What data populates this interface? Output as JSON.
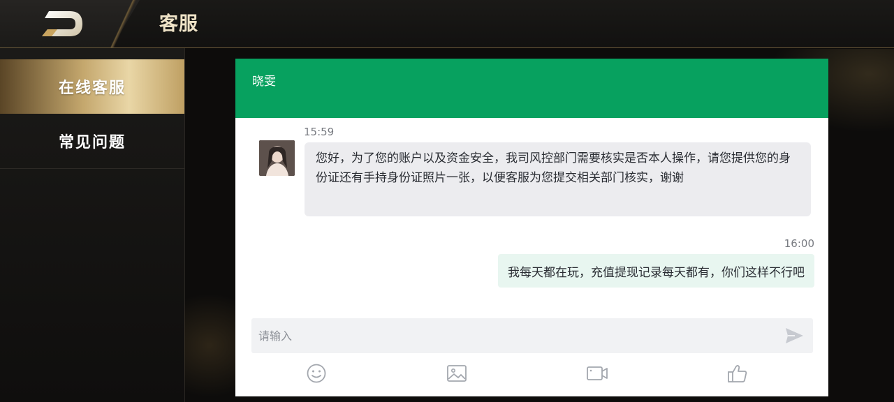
{
  "header": {
    "title": "客服",
    "logo_icon": "d-logo-icon"
  },
  "sidebar": {
    "items": [
      {
        "label": "在线客服",
        "active": true
      },
      {
        "label": "常见问题",
        "active": false
      }
    ]
  },
  "chat": {
    "agent_name": "晓雯",
    "header_color": "#07a15f",
    "messages": [
      {
        "direction": "incoming",
        "time": "15:59",
        "text": "您好，为了您的账户以及资金安全，我司风控部门需要核实是否本人操作，请您提供您的身份证还有手持身份证照片一张，以便客服为您提交相关部门核实，谢谢"
      },
      {
        "direction": "outgoing",
        "time": "16:00",
        "text": "我每天都在玩，充值提现记录每天都有，你们这样不行吧"
      }
    ],
    "input": {
      "placeholder": "请输入",
      "value": ""
    },
    "toolbar": [
      "smiley-icon",
      "image-icon",
      "video-icon",
      "thumbs-up-icon"
    ]
  },
  "colors": {
    "accent_gold": "#c4a76d",
    "chat_header": "#07a15f",
    "incoming_bubble": "#ececef",
    "outgoing_bubble": "#e8f6f0"
  }
}
